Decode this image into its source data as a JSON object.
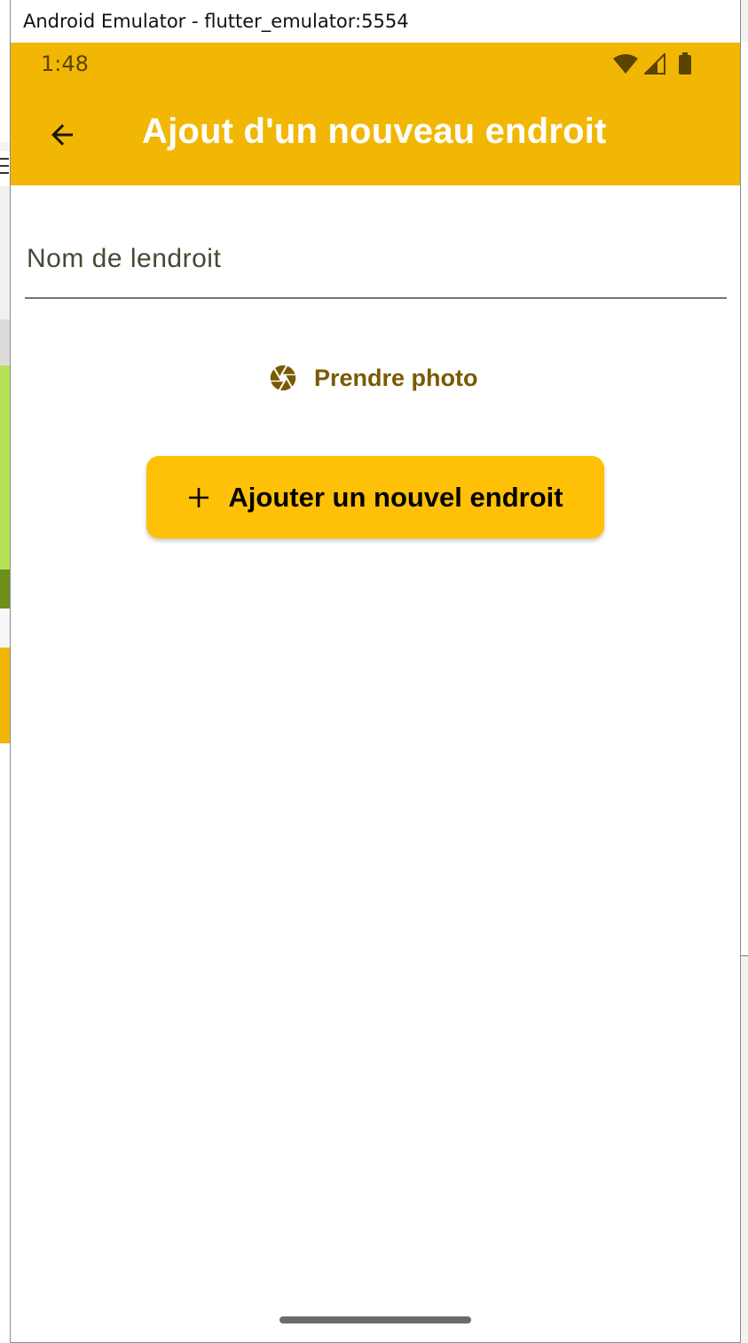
{
  "window": {
    "title": "Android Emulator - flutter_emulator:5554"
  },
  "status_bar": {
    "time": "1:48",
    "icons": [
      "wifi-icon",
      "cellular-signal-icon",
      "battery-icon"
    ]
  },
  "app_bar": {
    "title": "Ajout d'un nouveau endroit",
    "back_icon": "arrow-back-icon"
  },
  "form": {
    "name_field": {
      "placeholder": "Nom de lendroit",
      "value": ""
    },
    "photo_button": {
      "label": "Prendre photo",
      "icon": "camera-aperture-icon"
    },
    "add_button": {
      "label": "Ajouter un nouvel endroit",
      "icon": "plus-icon"
    }
  },
  "colors": {
    "app_bar": "#f2b705",
    "button": "#ffc107",
    "accent_text": "#7a5a00",
    "title_text": "#ffffff"
  }
}
